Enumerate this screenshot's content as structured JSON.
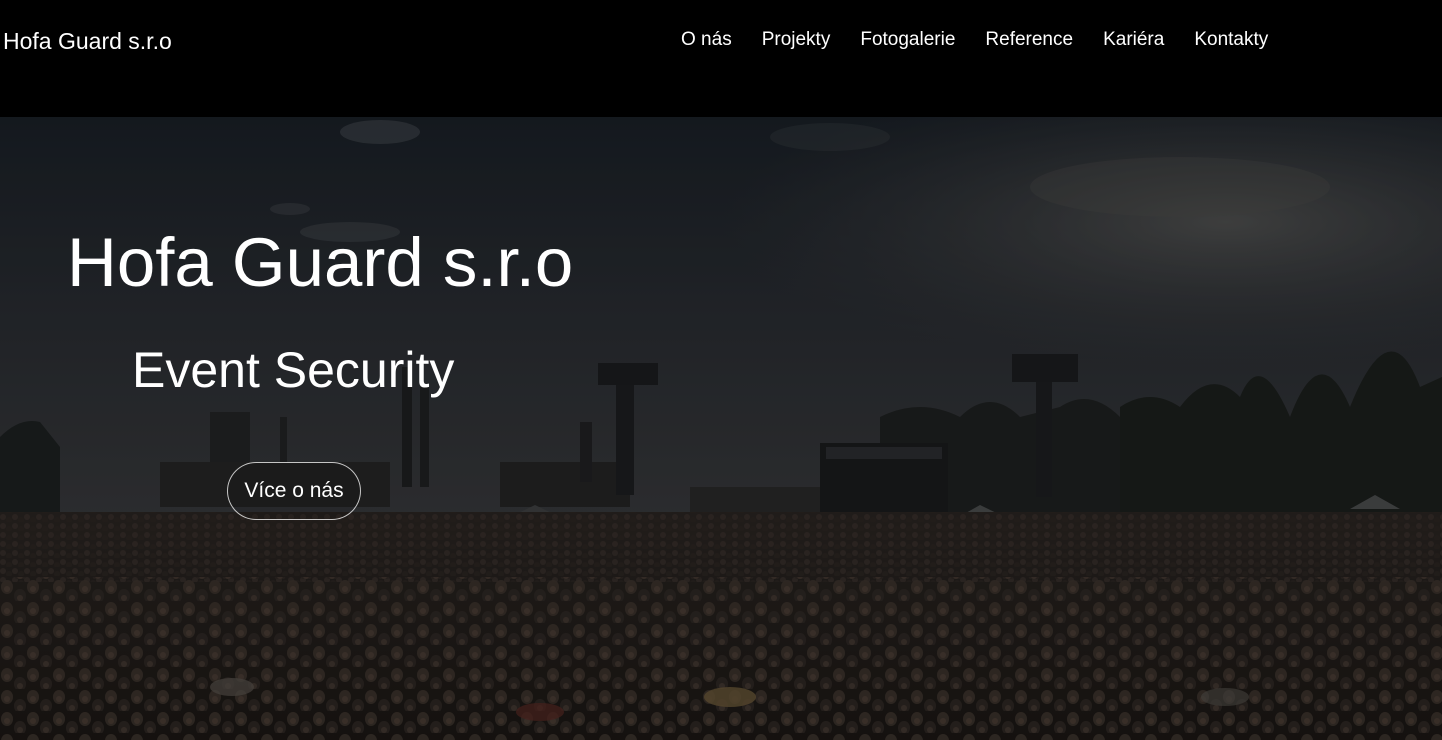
{
  "navbar": {
    "brand": "Hofa Guard s.r.o",
    "links": [
      {
        "label": "O nás"
      },
      {
        "label": "Projekty"
      },
      {
        "label": "Fotogalerie"
      },
      {
        "label": "Reference"
      },
      {
        "label": "Kariéra"
      },
      {
        "label": "Kontakty"
      }
    ]
  },
  "hero": {
    "title": "Hofa Guard s.r.o",
    "subtitle": "Event Security",
    "button_label": "Více o nás",
    "background_image": "dimmed-festival-crowd-photo"
  },
  "colors": {
    "navbar_background": "#000000",
    "text": "#ffffff",
    "hero_overlay": "#1f2024"
  }
}
